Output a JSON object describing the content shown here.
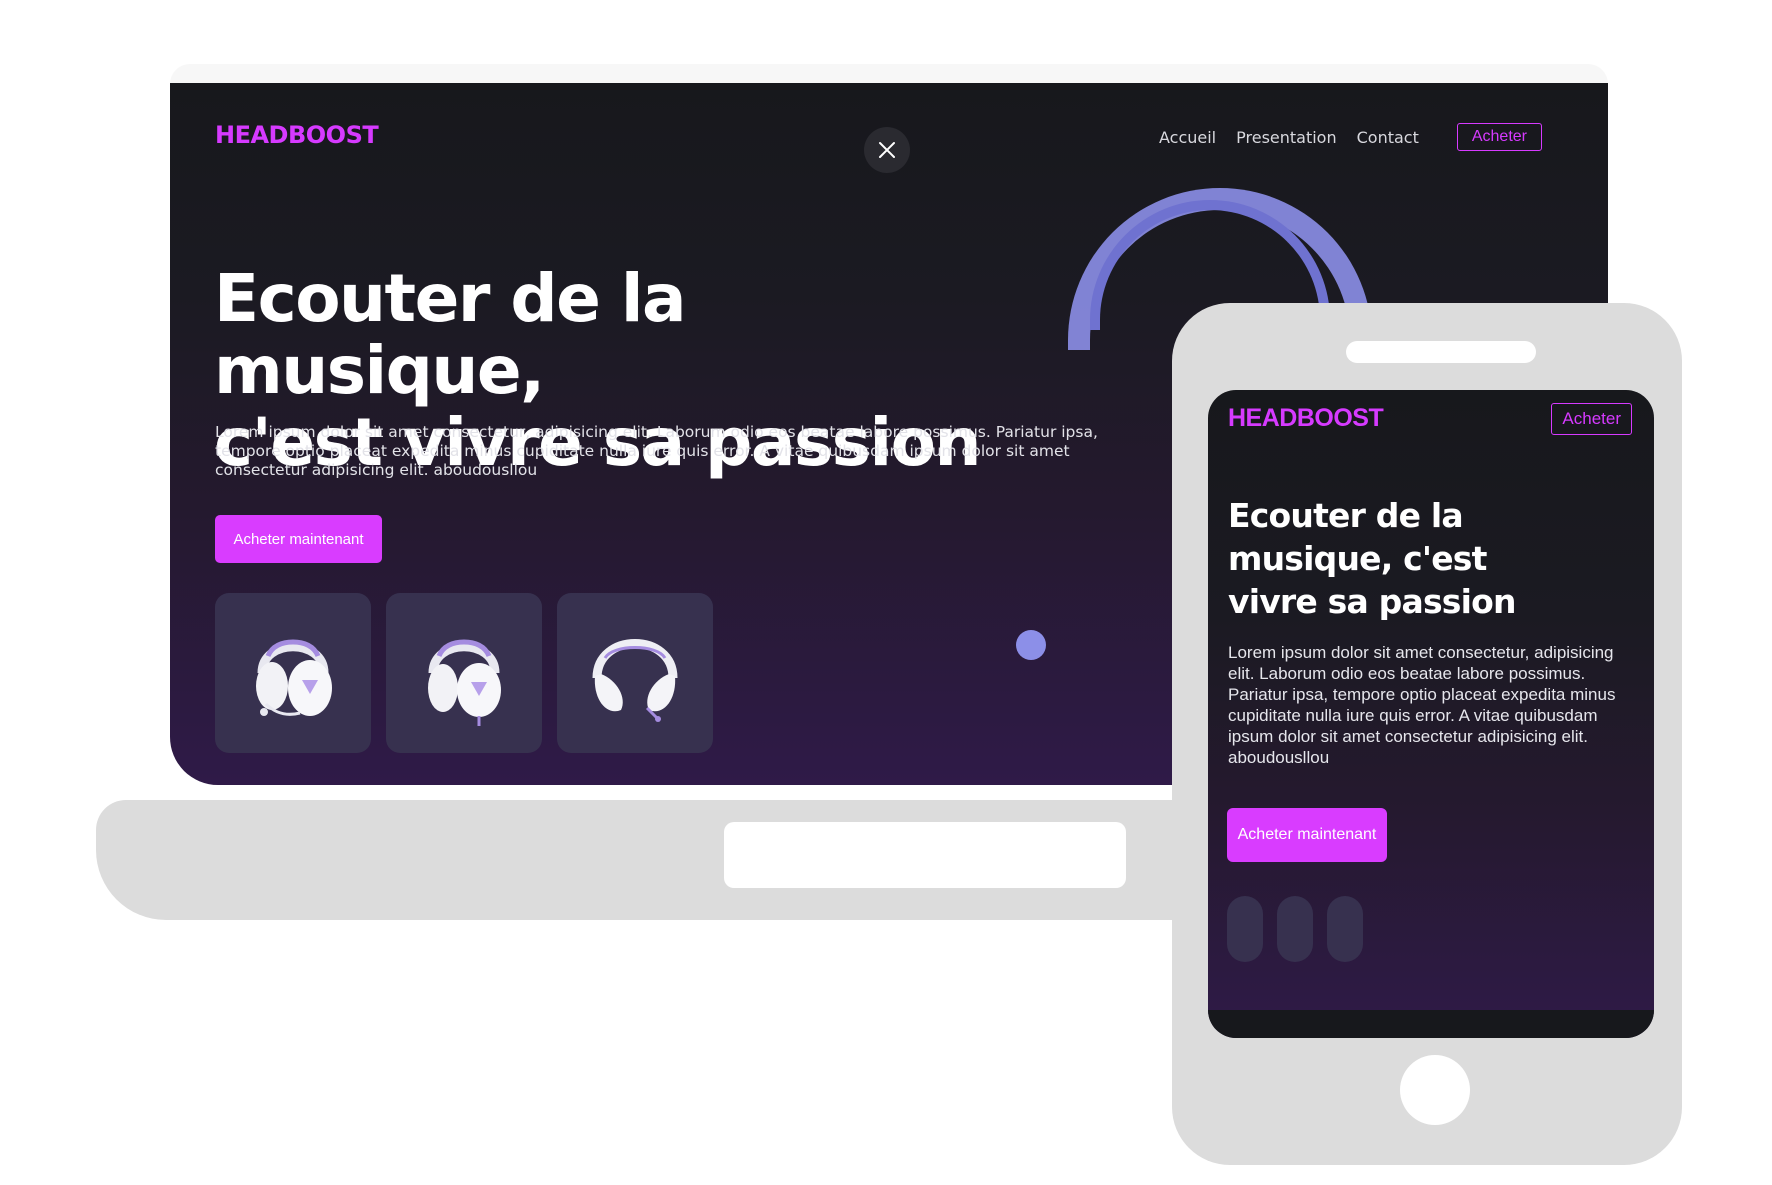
{
  "laptop": {
    "logo": "HEADBOOST",
    "nav": [
      "Accueil",
      "Presentation",
      "Contact"
    ],
    "buy_label": "Acheter",
    "title_line1": "Ecouter de la musique,",
    "title_line2": "c'est vivre sa passion",
    "body": "Lorem ipsum dolor sit amet consectetur, adipisicing elit. Laborum odio eos beatae labore possimus. Pariatur ipsa, tempore optio placeat expedita minus cupiditate nulla iure quis error. A vitae quibusdam ipsum dolor sit amet consectetur adipisicing elit. aboudousllou",
    "cta_label": "Acheter maintenant",
    "thumbnails": [
      "headphones-front",
      "headphones-front",
      "headphones-top"
    ]
  },
  "phone": {
    "logo": "HEADBOOST",
    "buy_label": "Acheter",
    "title": "Ecouter de la musique, c'est vivre sa passion",
    "body": "Lorem ipsum dolor sit amet consectetur, adipisicing elit. Laborum odio eos beatae labore possimus. Pariatur ipsa, tempore optio placeat expedita minus cupiditate nulla iure quis error. A vitae quibusdam ipsum dolor sit amet consectetur adipisicing elit. aboudousllou",
    "cta_label": "Acheter maintenant"
  },
  "colors": {
    "accent": "#d63aff",
    "background_top": "#17181c",
    "background_bottom": "#2f1a48",
    "thumb_bg": "#37314f",
    "device_frame": "#dcdcdc"
  }
}
